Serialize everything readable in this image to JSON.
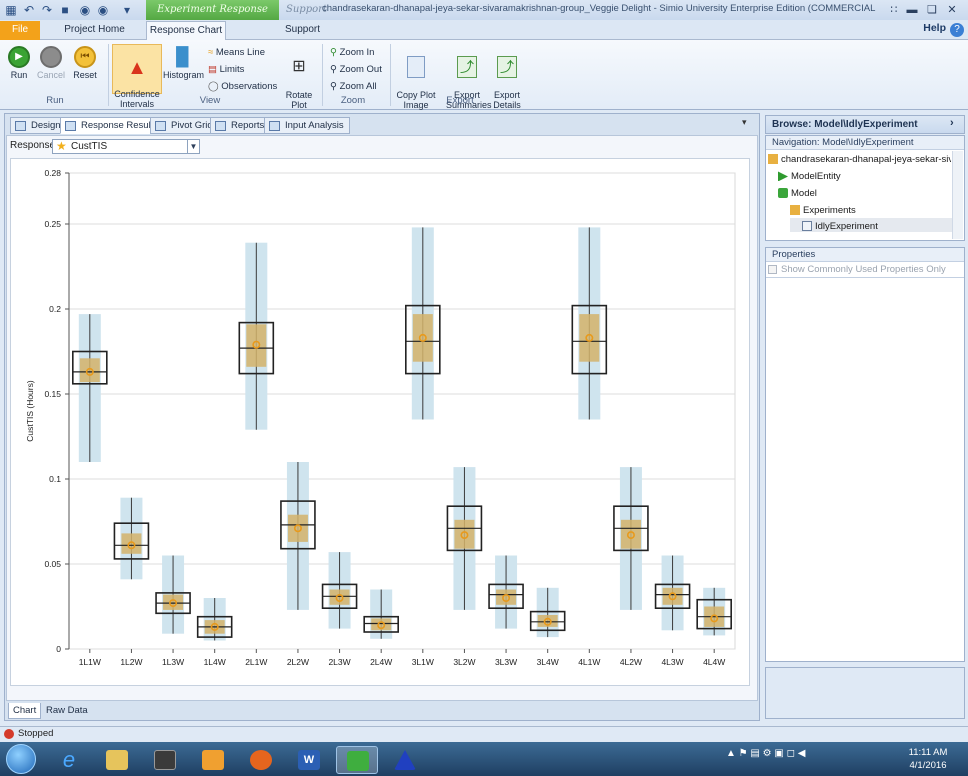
{
  "window": {
    "title": "chandrasekaran-dhanapal-jeya-sekar-sivaramakrishnan-group_Veggie Delight - Simio University Enterprise Edition (COMMERCIAL USE PROHIBITED) -...",
    "context_tab": "Experiment Response Tools",
    "context_support": "Support"
  },
  "ribbon_tabs": [
    "File",
    "Project Home",
    "Response Chart",
    "Support"
  ],
  "help": "Help",
  "ribbon": {
    "run": "Run",
    "cancel": "Cancel",
    "reset": "Reset",
    "confidence": "Confidence\nIntervals",
    "histogram": "Histogram",
    "means_line": "Means Line",
    "limits": "Limits",
    "observations": "Observations",
    "rotate": "Rotate\nPlot",
    "zoom_in": "Zoom In",
    "zoom_out": "Zoom Out",
    "zoom_all": "Zoom All",
    "copy": "Copy Plot\nImage",
    "export_summaries": "Export\nSummaries",
    "export_details": "Export\nDetails",
    "groups": [
      "Run",
      "View",
      "Zoom",
      "Export"
    ]
  },
  "doc_tabs": [
    "Design",
    "Response Results",
    "Pivot Grid",
    "Reports",
    "Input Analysis"
  ],
  "response": {
    "label": "Response:",
    "value": "CustTIS"
  },
  "bottom_tabs": [
    "Chart",
    "Raw Data"
  ],
  "status": "Stopped",
  "browse": {
    "title": "Browse: Model\\IdlyExperiment",
    "nav_label": "Navigation: Model\\IdlyExperiment",
    "items": [
      "chandrasekaran-dhanapal-jeya-sekar-sivarama",
      "ModelEntity",
      "Model",
      "Experiments",
      "IdlyExperiment"
    ]
  },
  "properties": {
    "title": "Properties",
    "checkbox": "Show Commonly Used Properties Only"
  },
  "clock": {
    "time": "11:11 AM",
    "date": "4/1/2016"
  },
  "colors": {
    "ci_band": "#cfe4ee",
    "mean_box": "#d4b36a",
    "mean_dot": "#e89a1c",
    "box_border": "#222222"
  },
  "chart_data": {
    "type": "box",
    "ylabel": "CustTIS (Hours)",
    "ylim": [
      0,
      0.28
    ],
    "yticks": [
      "0",
      "0.05",
      "0.1",
      "0.15",
      "0.2",
      "0.25",
      "0.28"
    ],
    "ytick_values": [
      0,
      0.05,
      0.1,
      0.15,
      0.2,
      0.25,
      0.28
    ],
    "categories": [
      "1L1W",
      "1L2W",
      "1L3W",
      "1L4W",
      "2L1W",
      "2L2W",
      "2L3W",
      "2L4W",
      "3L1W",
      "3L2W",
      "3L3W",
      "3L4W",
      "4L1W",
      "4L2W",
      "4L3W",
      "4L4W"
    ],
    "boxes": [
      {
        "min": 0.11,
        "max": 0.197,
        "q1": 0.156,
        "q3": 0.175,
        "median": 0.163,
        "mean": 0.163,
        "mean_lo": 0.157,
        "mean_hi": 0.171
      },
      {
        "min": 0.041,
        "max": 0.089,
        "q1": 0.053,
        "q3": 0.074,
        "median": 0.061,
        "mean": 0.061,
        "mean_lo": 0.056,
        "mean_hi": 0.068
      },
      {
        "min": 0.009,
        "max": 0.055,
        "q1": 0.021,
        "q3": 0.033,
        "median": 0.027,
        "mean": 0.027,
        "mean_lo": 0.023,
        "mean_hi": 0.032
      },
      {
        "min": 0.005,
        "max": 0.03,
        "q1": 0.007,
        "q3": 0.019,
        "median": 0.013,
        "mean": 0.013,
        "mean_lo": 0.009,
        "mean_hi": 0.017
      },
      {
        "min": 0.129,
        "max": 0.239,
        "q1": 0.162,
        "q3": 0.192,
        "median": 0.177,
        "mean": 0.179,
        "mean_lo": 0.166,
        "mean_hi": 0.191
      },
      {
        "min": 0.023,
        "max": 0.11,
        "q1": 0.059,
        "q3": 0.087,
        "median": 0.073,
        "mean": 0.071,
        "mean_lo": 0.063,
        "mean_hi": 0.079
      },
      {
        "min": 0.012,
        "max": 0.057,
        "q1": 0.024,
        "q3": 0.038,
        "median": 0.031,
        "mean": 0.03,
        "mean_lo": 0.026,
        "mean_hi": 0.035
      },
      {
        "min": 0.006,
        "max": 0.035,
        "q1": 0.01,
        "q3": 0.019,
        "median": 0.015,
        "mean": 0.014,
        "mean_lo": 0.011,
        "mean_hi": 0.018
      },
      {
        "min": 0.135,
        "max": 0.248,
        "q1": 0.162,
        "q3": 0.202,
        "median": 0.181,
        "mean": 0.183,
        "mean_lo": 0.169,
        "mean_hi": 0.197
      },
      {
        "min": 0.023,
        "max": 0.107,
        "q1": 0.058,
        "q3": 0.084,
        "median": 0.071,
        "mean": 0.067,
        "mean_lo": 0.059,
        "mean_hi": 0.076
      },
      {
        "min": 0.012,
        "max": 0.055,
        "q1": 0.024,
        "q3": 0.038,
        "median": 0.032,
        "mean": 0.03,
        "mean_lo": 0.026,
        "mean_hi": 0.035
      },
      {
        "min": 0.007,
        "max": 0.036,
        "q1": 0.011,
        "q3": 0.022,
        "median": 0.016,
        "mean": 0.016,
        "mean_lo": 0.013,
        "mean_hi": 0.02
      },
      {
        "min": 0.135,
        "max": 0.248,
        "q1": 0.162,
        "q3": 0.202,
        "median": 0.181,
        "mean": 0.183,
        "mean_lo": 0.169,
        "mean_hi": 0.197
      },
      {
        "min": 0.023,
        "max": 0.107,
        "q1": 0.058,
        "q3": 0.084,
        "median": 0.071,
        "mean": 0.067,
        "mean_lo": 0.059,
        "mean_hi": 0.076
      },
      {
        "min": 0.011,
        "max": 0.055,
        "q1": 0.024,
        "q3": 0.038,
        "median": 0.032,
        "mean": 0.031,
        "mean_lo": 0.026,
        "mean_hi": 0.036
      },
      {
        "min": 0.008,
        "max": 0.036,
        "q1": 0.012,
        "q3": 0.029,
        "median": 0.019,
        "mean": 0.018,
        "mean_lo": 0.013,
        "mean_hi": 0.025
      }
    ],
    "grid": "horizontal",
    "legend": "none"
  }
}
